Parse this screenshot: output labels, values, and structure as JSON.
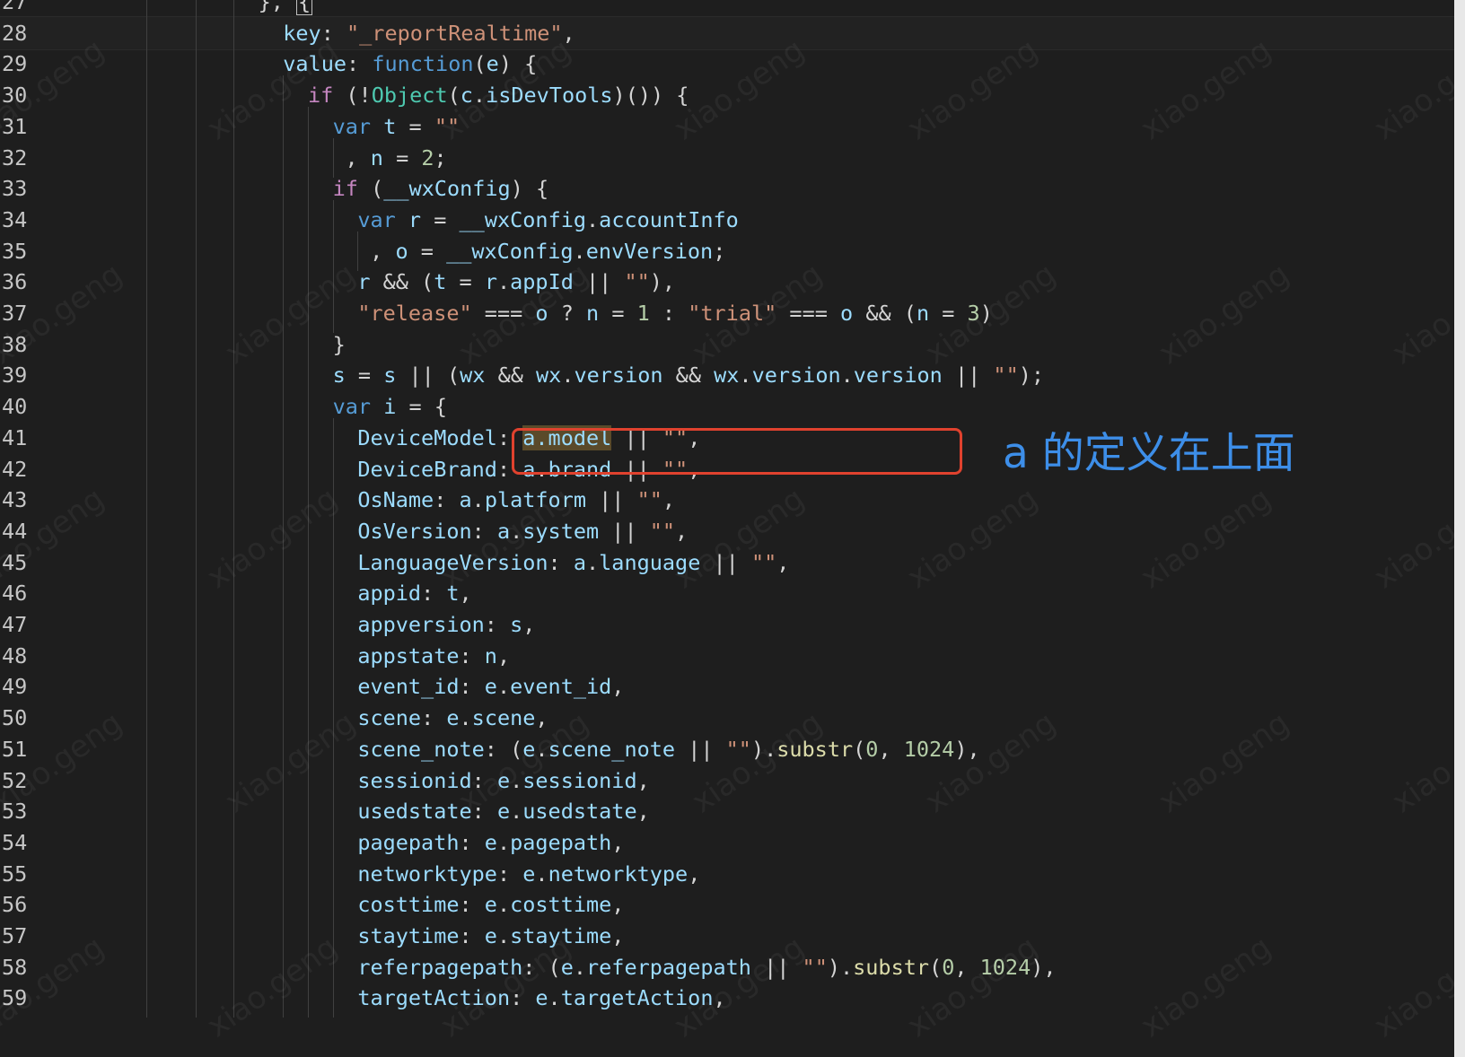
{
  "editor": {
    "lines": [
      {
        "n": "27",
        "indent": 15,
        "tokens": [
          [
            "o",
            "}, "
          ],
          [
            "caret",
            "{"
          ]
        ]
      },
      {
        "n": "28",
        "indent": 17,
        "hl": true,
        "tokens": [
          [
            "p",
            "key"
          ],
          [
            "o",
            ": "
          ],
          [
            "s",
            "\"_reportRealtime\""
          ],
          [
            "o",
            ","
          ]
        ]
      },
      {
        "n": "29",
        "indent": 17,
        "tokens": [
          [
            "p",
            "value"
          ],
          [
            "o",
            ": "
          ],
          [
            "k",
            "function"
          ],
          [
            "o",
            "("
          ],
          [
            "v",
            "e"
          ],
          [
            "o",
            ") {"
          ]
        ]
      },
      {
        "n": "30",
        "indent": 19,
        "tokens": [
          [
            "kc",
            "if"
          ],
          [
            "o",
            " (!"
          ],
          [
            "t",
            "Object"
          ],
          [
            "o",
            "("
          ],
          [
            "v",
            "c"
          ],
          [
            "o",
            "."
          ],
          [
            "v",
            "isDevTools"
          ],
          [
            "o",
            ")()) {"
          ]
        ]
      },
      {
        "n": "31",
        "indent": 21,
        "tokens": [
          [
            "k",
            "var"
          ],
          [
            "o",
            " "
          ],
          [
            "v",
            "t"
          ],
          [
            "o",
            " = "
          ],
          [
            "s",
            "\"\""
          ]
        ]
      },
      {
        "n": "32",
        "indent": 22,
        "tokens": [
          [
            "o",
            ", "
          ],
          [
            "v",
            "n"
          ],
          [
            "o",
            " = "
          ],
          [
            "n",
            "2"
          ],
          [
            "o",
            ";"
          ]
        ]
      },
      {
        "n": "33",
        "indent": 21,
        "tokens": [
          [
            "kc",
            "if"
          ],
          [
            "o",
            " ("
          ],
          [
            "v",
            "__wxConfig"
          ],
          [
            "o",
            ") {"
          ]
        ]
      },
      {
        "n": "34",
        "indent": 23,
        "tokens": [
          [
            "k",
            "var"
          ],
          [
            "o",
            " "
          ],
          [
            "v",
            "r"
          ],
          [
            "o",
            " = "
          ],
          [
            "v",
            "__wxConfig"
          ],
          [
            "o",
            "."
          ],
          [
            "v",
            "accountInfo"
          ]
        ]
      },
      {
        "n": "35",
        "indent": 24,
        "tokens": [
          [
            "o",
            ", "
          ],
          [
            "v",
            "o"
          ],
          [
            "o",
            " = "
          ],
          [
            "v",
            "__wxConfig"
          ],
          [
            "o",
            "."
          ],
          [
            "v",
            "envVersion"
          ],
          [
            "o",
            ";"
          ]
        ]
      },
      {
        "n": "36",
        "indent": 23,
        "tokens": [
          [
            "v",
            "r"
          ],
          [
            "o",
            " && ("
          ],
          [
            "v",
            "t"
          ],
          [
            "o",
            " = "
          ],
          [
            "v",
            "r"
          ],
          [
            "o",
            "."
          ],
          [
            "v",
            "appId"
          ],
          [
            "o",
            " || "
          ],
          [
            "s",
            "\"\""
          ],
          [
            "o",
            "),"
          ]
        ]
      },
      {
        "n": "37",
        "indent": 23,
        "tokens": [
          [
            "s",
            "\"release\""
          ],
          [
            "o",
            " === "
          ],
          [
            "v",
            "o"
          ],
          [
            "o",
            " ? "
          ],
          [
            "v",
            "n"
          ],
          [
            "o",
            " = "
          ],
          [
            "n",
            "1"
          ],
          [
            "o",
            " : "
          ],
          [
            "s",
            "\"trial\""
          ],
          [
            "o",
            " === "
          ],
          [
            "v",
            "o"
          ],
          [
            "o",
            " && ("
          ],
          [
            "v",
            "n"
          ],
          [
            "o",
            " = "
          ],
          [
            "n",
            "3"
          ],
          [
            "o",
            ")"
          ]
        ]
      },
      {
        "n": "38",
        "indent": 21,
        "tokens": [
          [
            "o",
            "}"
          ]
        ]
      },
      {
        "n": "39",
        "indent": 21,
        "tokens": [
          [
            "v",
            "s"
          ],
          [
            "o",
            " = "
          ],
          [
            "v",
            "s"
          ],
          [
            "o",
            " || ("
          ],
          [
            "v",
            "wx"
          ],
          [
            "o",
            " && "
          ],
          [
            "v",
            "wx"
          ],
          [
            "o",
            "."
          ],
          [
            "v",
            "version"
          ],
          [
            "o",
            " && "
          ],
          [
            "v",
            "wx"
          ],
          [
            "o",
            "."
          ],
          [
            "v",
            "version"
          ],
          [
            "o",
            "."
          ],
          [
            "v",
            "version"
          ],
          [
            "o",
            " || "
          ],
          [
            "s",
            "\"\""
          ],
          [
            "o",
            ");"
          ]
        ]
      },
      {
        "n": "40",
        "indent": 21,
        "tokens": [
          [
            "k",
            "var"
          ],
          [
            "o",
            " "
          ],
          [
            "v",
            "i"
          ],
          [
            "o",
            " = {"
          ]
        ]
      },
      {
        "n": "41",
        "indent": 23,
        "tokens": [
          [
            "p",
            "DeviceModel"
          ],
          [
            "o",
            ": "
          ],
          [
            "match",
            "a.model"
          ],
          [
            "o",
            " || "
          ],
          [
            "s",
            "\"\""
          ],
          [
            "o",
            ","
          ]
        ]
      },
      {
        "n": "42",
        "indent": 23,
        "tokens": [
          [
            "p",
            "DeviceBrand"
          ],
          [
            "o",
            ": "
          ],
          [
            "v",
            "a"
          ],
          [
            "o",
            "."
          ],
          [
            "v",
            "brand"
          ],
          [
            "o",
            " || "
          ],
          [
            "s",
            "\"\""
          ],
          [
            "o",
            ","
          ]
        ]
      },
      {
        "n": "43",
        "indent": 23,
        "tokens": [
          [
            "p",
            "OsName"
          ],
          [
            "o",
            ": "
          ],
          [
            "v",
            "a"
          ],
          [
            "o",
            "."
          ],
          [
            "v",
            "platform"
          ],
          [
            "o",
            " || "
          ],
          [
            "s",
            "\"\""
          ],
          [
            "o",
            ","
          ]
        ]
      },
      {
        "n": "44",
        "indent": 23,
        "tokens": [
          [
            "p",
            "OsVersion"
          ],
          [
            "o",
            ": "
          ],
          [
            "v",
            "a"
          ],
          [
            "o",
            "."
          ],
          [
            "v",
            "system"
          ],
          [
            "o",
            " || "
          ],
          [
            "s",
            "\"\""
          ],
          [
            "o",
            ","
          ]
        ]
      },
      {
        "n": "45",
        "indent": 23,
        "tokens": [
          [
            "p",
            "LanguageVersion"
          ],
          [
            "o",
            ": "
          ],
          [
            "v",
            "a"
          ],
          [
            "o",
            "."
          ],
          [
            "v",
            "language"
          ],
          [
            "o",
            " || "
          ],
          [
            "s",
            "\"\""
          ],
          [
            "o",
            ","
          ]
        ]
      },
      {
        "n": "46",
        "indent": 23,
        "tokens": [
          [
            "p",
            "appid"
          ],
          [
            "o",
            ": "
          ],
          [
            "v",
            "t"
          ],
          [
            "o",
            ","
          ]
        ]
      },
      {
        "n": "47",
        "indent": 23,
        "tokens": [
          [
            "p",
            "appversion"
          ],
          [
            "o",
            ": "
          ],
          [
            "v",
            "s"
          ],
          [
            "o",
            ","
          ]
        ]
      },
      {
        "n": "48",
        "indent": 23,
        "tokens": [
          [
            "p",
            "appstate"
          ],
          [
            "o",
            ": "
          ],
          [
            "v",
            "n"
          ],
          [
            "o",
            ","
          ]
        ]
      },
      {
        "n": "49",
        "indent": 23,
        "tokens": [
          [
            "p",
            "event_id"
          ],
          [
            "o",
            ": "
          ],
          [
            "v",
            "e"
          ],
          [
            "o",
            "."
          ],
          [
            "v",
            "event_id"
          ],
          [
            "o",
            ","
          ]
        ]
      },
      {
        "n": "50",
        "indent": 23,
        "tokens": [
          [
            "p",
            "scene"
          ],
          [
            "o",
            ": "
          ],
          [
            "v",
            "e"
          ],
          [
            "o",
            "."
          ],
          [
            "v",
            "scene"
          ],
          [
            "o",
            ","
          ]
        ]
      },
      {
        "n": "51",
        "indent": 23,
        "tokens": [
          [
            "p",
            "scene_note"
          ],
          [
            "o",
            ": ("
          ],
          [
            "v",
            "e"
          ],
          [
            "o",
            "."
          ],
          [
            "v",
            "scene_note"
          ],
          [
            "o",
            " || "
          ],
          [
            "s",
            "\"\""
          ],
          [
            "o",
            ")."
          ],
          [
            "f",
            "substr"
          ],
          [
            "o",
            "("
          ],
          [
            "n",
            "0"
          ],
          [
            "o",
            ", "
          ],
          [
            "n",
            "1024"
          ],
          [
            "o",
            "),"
          ]
        ]
      },
      {
        "n": "52",
        "indent": 23,
        "tokens": [
          [
            "p",
            "sessionid"
          ],
          [
            "o",
            ": "
          ],
          [
            "v",
            "e"
          ],
          [
            "o",
            "."
          ],
          [
            "v",
            "sessionid"
          ],
          [
            "o",
            ","
          ]
        ]
      },
      {
        "n": "53",
        "indent": 23,
        "tokens": [
          [
            "p",
            "usedstate"
          ],
          [
            "o",
            ": "
          ],
          [
            "v",
            "e"
          ],
          [
            "o",
            "."
          ],
          [
            "v",
            "usedstate"
          ],
          [
            "o",
            ","
          ]
        ]
      },
      {
        "n": "54",
        "indent": 23,
        "tokens": [
          [
            "p",
            "pagepath"
          ],
          [
            "o",
            ": "
          ],
          [
            "v",
            "e"
          ],
          [
            "o",
            "."
          ],
          [
            "v",
            "pagepath"
          ],
          [
            "o",
            ","
          ]
        ]
      },
      {
        "n": "55",
        "indent": 23,
        "tokens": [
          [
            "p",
            "networktype"
          ],
          [
            "o",
            ": "
          ],
          [
            "v",
            "e"
          ],
          [
            "o",
            "."
          ],
          [
            "v",
            "networktype"
          ],
          [
            "o",
            ","
          ]
        ]
      },
      {
        "n": "56",
        "indent": 23,
        "tokens": [
          [
            "p",
            "costtime"
          ],
          [
            "o",
            ": "
          ],
          [
            "v",
            "e"
          ],
          [
            "o",
            "."
          ],
          [
            "v",
            "costtime"
          ],
          [
            "o",
            ","
          ]
        ]
      },
      {
        "n": "57",
        "indent": 23,
        "tokens": [
          [
            "p",
            "staytime"
          ],
          [
            "o",
            ": "
          ],
          [
            "v",
            "e"
          ],
          [
            "o",
            "."
          ],
          [
            "v",
            "staytime"
          ],
          [
            "o",
            ","
          ]
        ]
      },
      {
        "n": "58",
        "indent": 23,
        "tokens": [
          [
            "p",
            "referpagepath"
          ],
          [
            "o",
            ": ("
          ],
          [
            "v",
            "e"
          ],
          [
            "o",
            "."
          ],
          [
            "v",
            "referpagepath"
          ],
          [
            "o",
            " || "
          ],
          [
            "s",
            "\"\""
          ],
          [
            "o",
            ")."
          ],
          [
            "f",
            "substr"
          ],
          [
            "o",
            "("
          ],
          [
            "n",
            "0"
          ],
          [
            "o",
            ", "
          ],
          [
            "n",
            "1024"
          ],
          [
            "o",
            "),"
          ]
        ]
      },
      {
        "n": "59",
        "indent": 23,
        "tokens": [
          [
            "p",
            "targetAction"
          ],
          [
            "o",
            ": "
          ],
          [
            "v",
            "e"
          ],
          [
            "o",
            "."
          ],
          [
            "v",
            "targetAction"
          ],
          [
            "o",
            ","
          ]
        ]
      }
    ]
  },
  "annotation": {
    "text": "a 的定义在上面",
    "color": "#3d8ee8",
    "box_color": "#e0422e"
  },
  "watermark": {
    "text": "xiao.geng"
  }
}
